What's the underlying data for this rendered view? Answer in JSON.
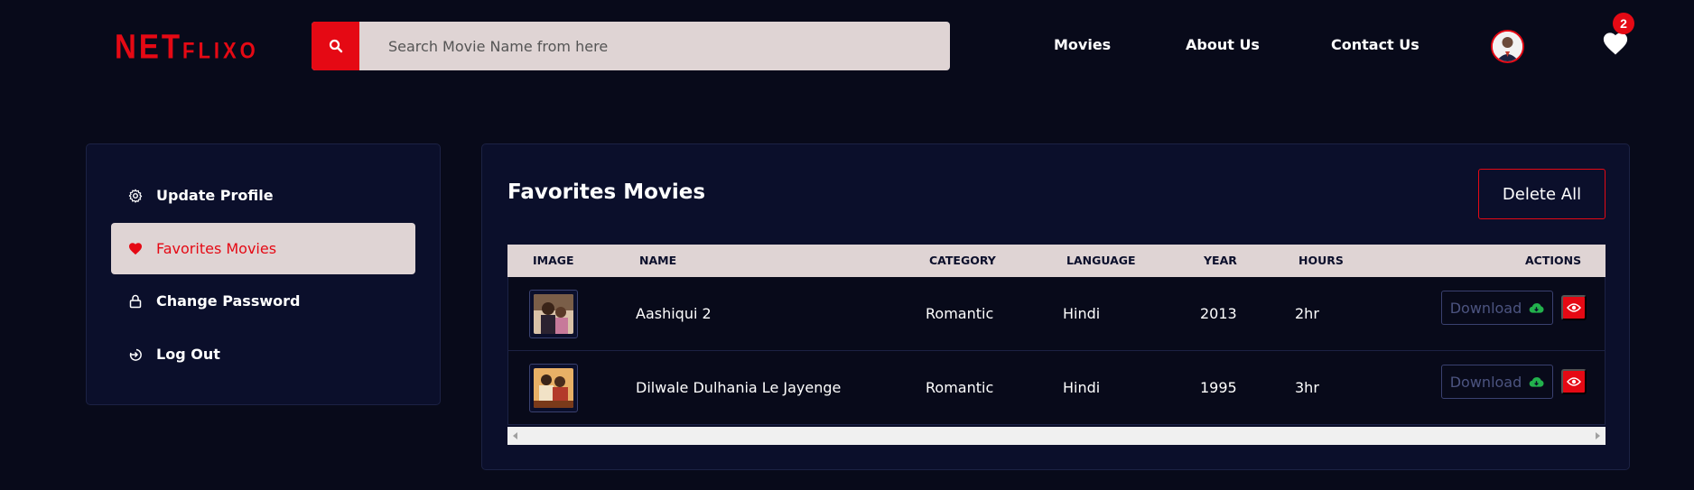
{
  "header": {
    "logo_big": "NET",
    "logo_small": "FLIXO",
    "search_placeholder": "Search Movie Name from here",
    "nav": [
      {
        "label": "Movies"
      },
      {
        "label": "About Us"
      },
      {
        "label": "Contact Us"
      }
    ],
    "favorites_count": "2",
    "icons": {
      "search": "search-icon",
      "favorites": "heart-icon",
      "avatar": "user-avatar"
    }
  },
  "sidebar": {
    "items": [
      {
        "label": "Update Profile",
        "icon": "gear-icon",
        "active": false
      },
      {
        "label": "Favorites Movies",
        "icon": "heart-icon",
        "active": true
      },
      {
        "label": "Change Password",
        "icon": "lock-icon",
        "active": false
      },
      {
        "label": "Log Out",
        "icon": "logout-icon",
        "active": false
      }
    ]
  },
  "main": {
    "title": "Favorites Movies",
    "delete_all_label": "Delete All",
    "table": {
      "columns": [
        "IMAGE",
        "NAME",
        "CATEGORY",
        "LANGUAGE",
        "YEAR",
        "HOURS",
        "ACTIONS"
      ],
      "rows": [
        {
          "name": "Aashiqui 2",
          "category": "Romantic",
          "language": "Hindi",
          "year": "2013",
          "hours": "2hr",
          "download_label": "Download"
        },
        {
          "name": "Dilwale Dulhania Le Jayenge",
          "category": "Romantic",
          "language": "Hindi",
          "year": "1995",
          "hours": "3hr",
          "download_label": "Download"
        }
      ]
    }
  },
  "colors": {
    "background": "#080a1a",
    "panel": "#0b0f2b",
    "accent": "#e50914",
    "light": "#dfd4d4",
    "cloud_icon": "#22b14c"
  }
}
